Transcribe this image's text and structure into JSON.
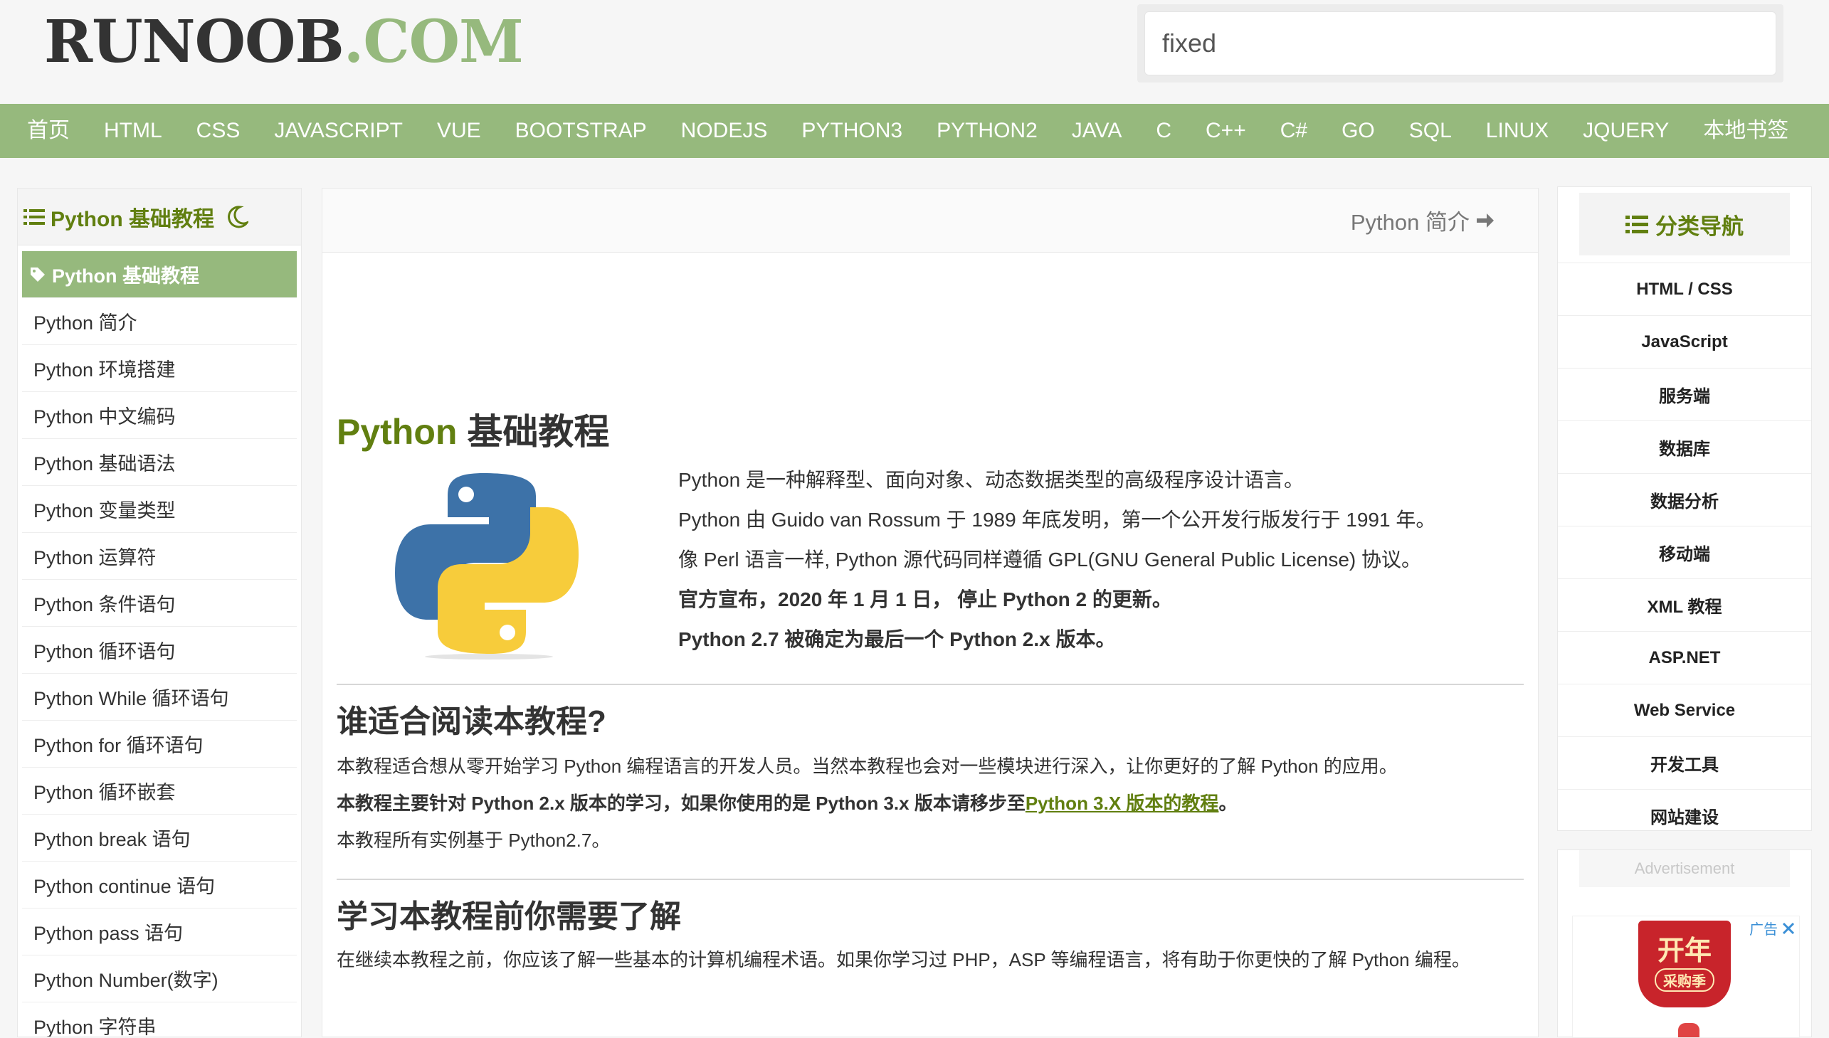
{
  "header": {
    "logo_part1": "RUNOOB",
    "logo_part2": ".COM",
    "search_value": "fixed"
  },
  "nav": [
    "首页",
    "HTML",
    "CSS",
    "JAVASCRIPT",
    "VUE",
    "BOOTSTRAP",
    "NODEJS",
    "PYTHON3",
    "PYTHON2",
    "JAVA",
    "C",
    "C++",
    "C#",
    "GO",
    "SQL",
    "LINUX",
    "JQUERY",
    "本地书签"
  ],
  "left_sidebar": {
    "title": "Python 基础教程",
    "active_item": "Python 基础教程",
    "items": [
      "Python 简介",
      "Python 环境搭建",
      "Python 中文编码",
      "Python 基础语法",
      "Python 变量类型",
      "Python 运算符",
      "Python 条件语句",
      "Python 循环语句",
      "Python While 循环语句",
      "Python for 循环语句",
      "Python 循环嵌套",
      "Python break 语句",
      "Python continue 语句",
      "Python pass 语句",
      "Python Number(数字)",
      "Python 字符串"
    ]
  },
  "main": {
    "next_link": "Python 简介",
    "title_prefix": "Python",
    "title_suffix": " 基础教程",
    "intro": [
      "Python 是一种解释型、面向对象、动态数据类型的高级程序设计语言。",
      "Python 由 Guido van Rossum 于 1989 年底发明，第一个公开发行版发行于 1991 年。",
      "像 Perl 语言一样, Python 源代码同样遵循 GPL(GNU General Public License) 协议。"
    ],
    "intro_bold": [
      "官方宣布，2020 年 1 月 1 日， 停止 Python 2 的更新。",
      "Python 2.7 被确定为最后一个 Python 2.x 版本。"
    ],
    "section1": {
      "heading": "谁适合阅读本教程?",
      "p1": "本教程适合想从零开始学习 Python 编程语言的开发人员。当然本教程也会对一些模块进行深入，让你更好的了解 Python 的应用。",
      "p2_before": "本教程主要针对 Python 2.x 版本的学习，如果你使用的是 Python 3.x 版本请移步至",
      "p2_link": "Python 3.X 版本的教程",
      "p2_after": "。",
      "p3": "本教程所有实例基于 Python2.7。"
    },
    "section2": {
      "heading": "学习本教程前你需要了解",
      "p1": "在继续本教程之前，你应该了解一些基本的计算机编程术语。如果你学习过 PHP，ASP 等编程语言，将有助于你更快的了解 Python 编程。"
    }
  },
  "right_sidebar": {
    "title": "分类导航",
    "items": [
      "HTML / CSS",
      "JavaScript",
      "服务端",
      "数据库",
      "数据分析",
      "移动端",
      "XML 教程",
      "ASP.NET",
      "Web Service",
      "开发工具",
      "网站建设"
    ],
    "ad_label": "Advertisement",
    "ad_tag": "广告",
    "ad_line1": "开年",
    "ad_line2": "采购季"
  },
  "colors": {
    "brand_green": "#96b97d",
    "dark_green": "#617f10",
    "python_blue": "#3d72a8",
    "python_yellow": "#f7cc3b"
  }
}
